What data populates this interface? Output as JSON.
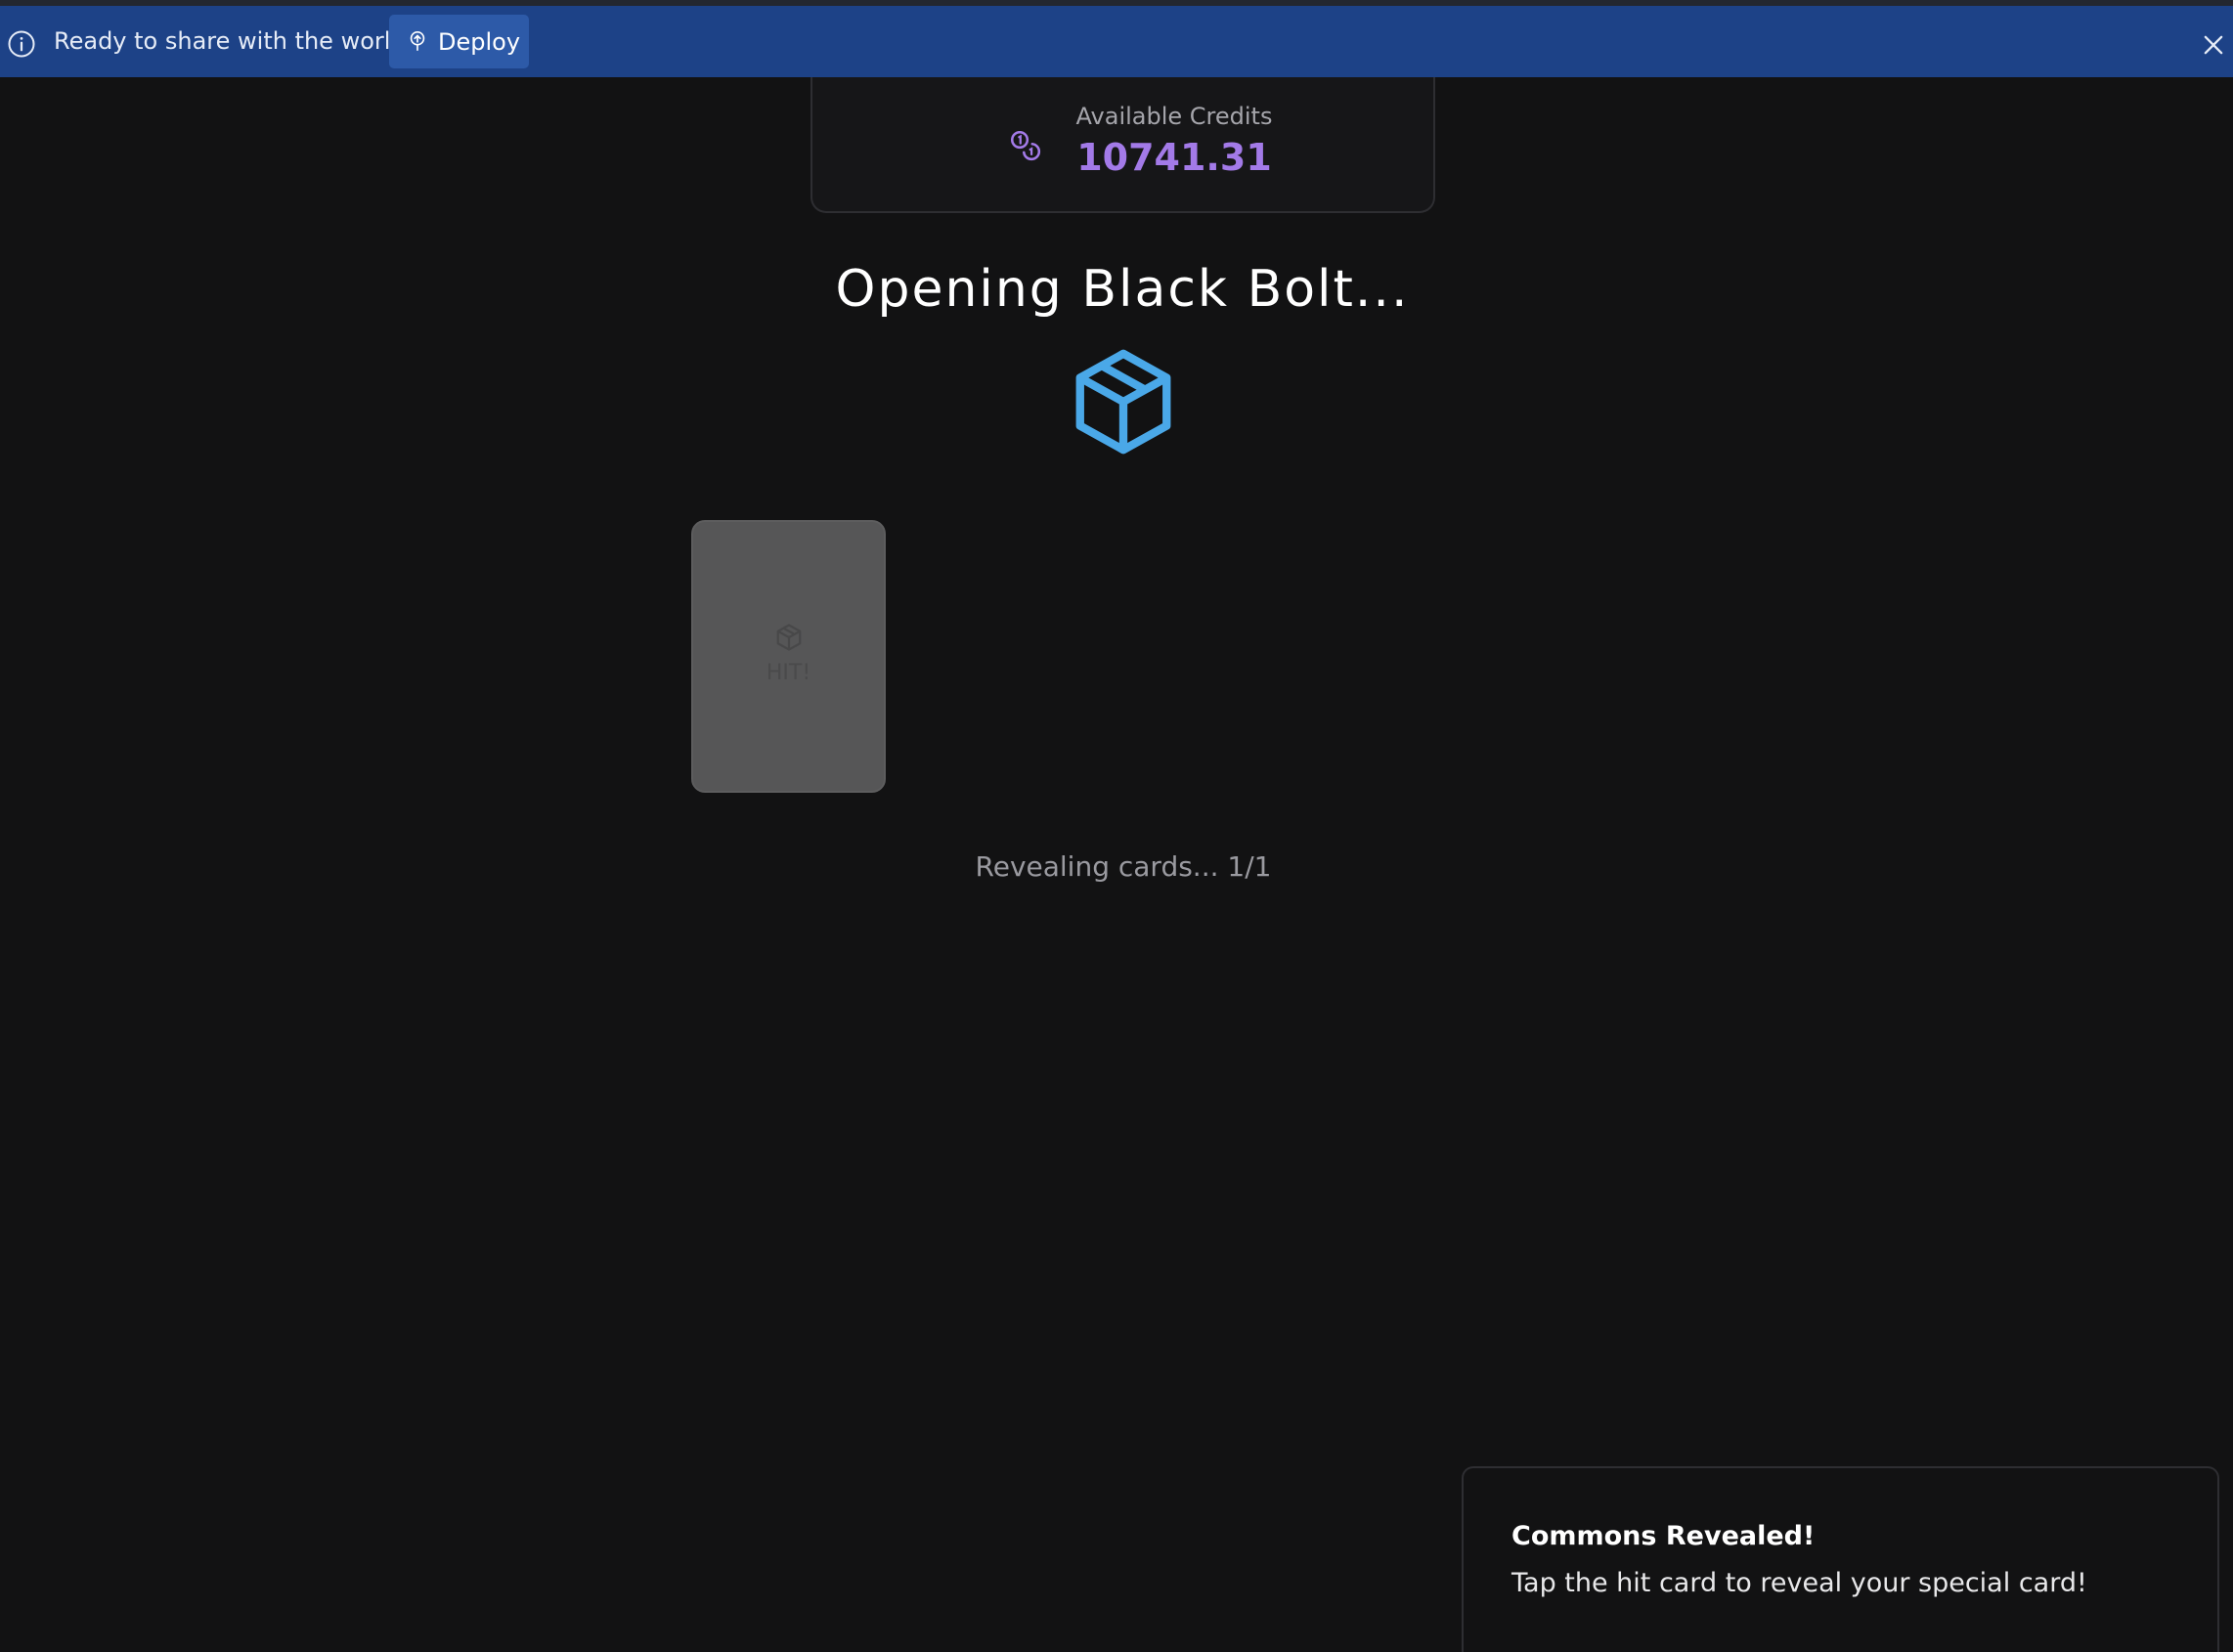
{
  "banner": {
    "message": "Ready to share with the world?",
    "deploy_label": "Deploy",
    "background": "#1d4287"
  },
  "credits": {
    "label": "Available Credits",
    "amount": "10741.31",
    "accent": "#a37ae8"
  },
  "pack": {
    "title": "Opening Black Bolt...",
    "icon": "box-icon",
    "icon_color": "#4aa8e8"
  },
  "cards": [
    {
      "label": "HIT!",
      "icon": "box-icon"
    }
  ],
  "status": {
    "text": "Revealing cards... 1/1"
  },
  "toast": {
    "title": "Commons Revealed!",
    "description": "Tap the hit card to reveal your special card!"
  }
}
